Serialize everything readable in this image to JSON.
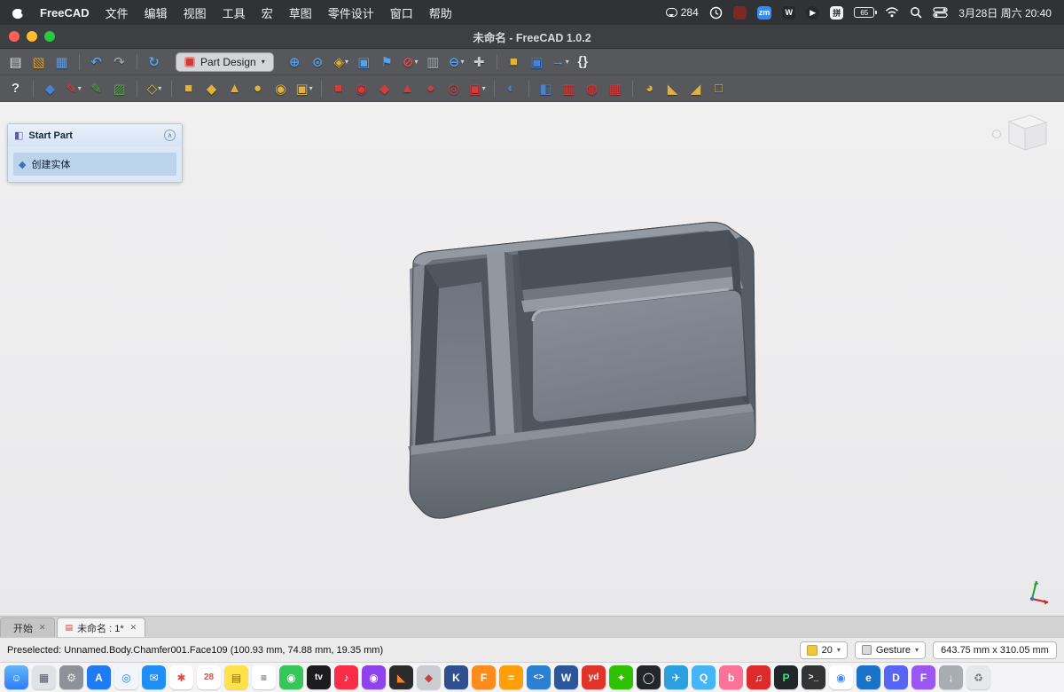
{
  "menu_bar": {
    "app_name": "FreeCAD",
    "items": [
      "文件",
      "编辑",
      "视图",
      "工具",
      "宏",
      "草图",
      "零件设计",
      "窗口",
      "帮助"
    ],
    "status": {
      "chat_count": "284",
      "zoom_badge": "zm",
      "word_badge": "W",
      "play_glyph": "▶",
      "pinyin_badge": "拼",
      "battery_percent": "65",
      "datetime": "3月28日 周六 20:40"
    }
  },
  "window": {
    "title": "未命名 - FreeCAD 1.0.2"
  },
  "toolbars": {
    "workbench_selector": {
      "label": "Part Design",
      "arrow": "▾"
    },
    "row1_left": [
      {
        "name": "new-file-icon",
        "glyph": "▤",
        "style": "color:#e9edf2"
      },
      {
        "name": "open-folder-icon",
        "glyph": "▧",
        "style": "color:#e0a23c"
      },
      {
        "name": "save-icon",
        "glyph": "▦",
        "style": "color:#6fa0d8"
      },
      {
        "cls": "tsep",
        "inter": "false"
      },
      {
        "name": "undo-icon",
        "glyph": "↶",
        "style": "color:#58a0e8"
      },
      {
        "name": "redo-icon",
        "glyph": "↷",
        "style": "color:#9aa0a6"
      },
      {
        "cls": "tsep",
        "inter": "false"
      },
      {
        "name": "refresh-icon",
        "glyph": "↻",
        "style": "color:#58a0e8"
      }
    ],
    "row1_view": [
      {
        "name": "fit-all-icon",
        "glyph": "⊕",
        "style": "color:#58a0e8"
      },
      {
        "name": "fit-selection-icon",
        "glyph": "⊙",
        "style": "color:#58a0e8"
      },
      {
        "name": "isometric-view-icon",
        "glyph": "◈",
        "style": "color:#d9b23c",
        "dd": "▾"
      },
      {
        "name": "box-zoom-icon",
        "glyph": "▣",
        "style": "color:#58a0e8"
      },
      {
        "name": "sync-view-icon",
        "glyph": "⚑",
        "style": "color:#58a0e8"
      },
      {
        "name": "draw-style-icon",
        "glyph": "⊘",
        "style": "color:#e05252",
        "dd": "▾"
      },
      {
        "name": "clip-plane-icon",
        "glyph": "▥",
        "style": "color:#9fb3c8"
      },
      {
        "name": "zoom-out-icon",
        "glyph": "⊖",
        "style": "color:#58a0e8",
        "dd": "▾"
      },
      {
        "name": "measure-icon",
        "glyph": "✚",
        "style": "color:#c7ccd2"
      },
      {
        "cls": "tsep",
        "inter": "false"
      },
      {
        "name": "part-icon",
        "glyph": "■",
        "style": "color:#e2b33c"
      },
      {
        "name": "group-icon",
        "glyph": "▣",
        "style": "color:#4a80d0"
      },
      {
        "name": "export-icon",
        "glyph": "→",
        "style": "color:#58a0e8",
        "dd": "▾"
      },
      {
        "name": "macro-braces-icon",
        "glyph": "{}",
        "style": "color:#e9edf2"
      }
    ],
    "row2": [
      {
        "name": "whatsthis-icon",
        "glyph": "?",
        "style": "color:#e9edf2"
      },
      {
        "cls": "tsep",
        "inter": "false"
      },
      {
        "name": "create-body-icon",
        "glyph": "◆",
        "style": "color:#4a80d0"
      },
      {
        "name": "create-sketch-icon",
        "glyph": "✎",
        "style": "color:#d84b4b",
        "dd": "▾"
      },
      {
        "name": "edit-sketch-icon",
        "glyph": "✎",
        "style": "color:#57a64a"
      },
      {
        "name": "map-sketch-icon",
        "glyph": "▨",
        "style": "color:#57a64a"
      },
      {
        "cls": "tsep",
        "inter": "false"
      },
      {
        "name": "create-datum-icon",
        "glyph": "◇",
        "style": "color:#e2b33c",
        "dd": "▾"
      },
      {
        "cls": "tsep",
        "inter": "false"
      },
      {
        "name": "pad-icon",
        "glyph": "■",
        "style": "color:#e2b33c"
      },
      {
        "name": "revolution-icon",
        "glyph": "◆",
        "style": "color:#e2b33c"
      },
      {
        "name": "additive-loft-icon",
        "glyph": "▲",
        "style": "color:#e2b33c"
      },
      {
        "name": "additive-pipe-icon",
        "glyph": "●",
        "style": "color:#e2b33c"
      },
      {
        "name": "additive-helix-icon",
        "glyph": "◉",
        "style": "color:#e2b33c"
      },
      {
        "name": "additive-primitive-icon",
        "glyph": "▣",
        "style": "color:#e2b33c",
        "dd": "▾"
      },
      {
        "cls": "tsep",
        "inter": "false"
      },
      {
        "name": "pocket-icon",
        "glyph": "■",
        "style": "color:#cf3d3d"
      },
      {
        "name": "hole-icon",
        "glyph": "◉",
        "style": "color:#cf3d3d"
      },
      {
        "name": "groove-icon",
        "glyph": "◆",
        "style": "color:#cf3d3d"
      },
      {
        "name": "subtractive-loft-icon",
        "glyph": "▲",
        "style": "color:#cf3d3d"
      },
      {
        "name": "subtractive-pipe-icon",
        "glyph": "●",
        "style": "color:#cf3d3d"
      },
      {
        "name": "subtractive-helix-icon",
        "glyph": "◎",
        "style": "color:#cf3d3d"
      },
      {
        "name": "subtractive-primitive-icon",
        "glyph": "▣",
        "style": "color:#cf3d3d",
        "dd": "▾"
      },
      {
        "cls": "tsep",
        "inter": "false"
      },
      {
        "name": "boolean-icon",
        "glyph": "◐",
        "style": "color:#4a80d0"
      },
      {
        "cls": "tsep",
        "inter": "false"
      },
      {
        "name": "mirrored-icon",
        "glyph": "◧",
        "style": "color:#4a80d0"
      },
      {
        "name": "linear-pattern-icon",
        "glyph": "▥",
        "style": "color:#cf3d3d"
      },
      {
        "name": "polar-pattern-icon",
        "glyph": "◍",
        "style": "color:#cf3d3d"
      },
      {
        "name": "multitransform-icon",
        "glyph": "▦",
        "style": "color:#cf3d3d"
      },
      {
        "cls": "tsep",
        "inter": "false"
      },
      {
        "name": "fillet-icon",
        "glyph": "◕",
        "style": "color:#e2b33c"
      },
      {
        "name": "chamfer-icon",
        "glyph": "◣",
        "style": "color:#e2b33c"
      },
      {
        "name": "draft-icon",
        "glyph": "◢",
        "style": "color:#e2b33c"
      },
      {
        "name": "thickness-icon",
        "glyph": "□",
        "style": "color:#e2b33c"
      }
    ]
  },
  "task_panel": {
    "title": "Start Part",
    "collapse_glyph": "∧",
    "items": [
      {
        "name": "create-solid-item",
        "label": "创建实体",
        "glyph": "◆",
        "style": "color:#3f6fb5"
      }
    ]
  },
  "tab_bar": {
    "tabs": [
      {
        "name": "tab-start",
        "label": "开始",
        "close": "✕",
        "cls": "tab"
      },
      {
        "name": "tab-document",
        "label": "未命名 : 1*",
        "close": "✕",
        "cls": "tab active",
        "icon": "▤",
        "iconstyle": "color:#cf3d3d"
      }
    ]
  },
  "status_bar": {
    "message": "Preselected: Unnamed.Body.Chamfer001.Face109 (100.93 mm, 74.88 mm, 19.35 mm)",
    "scale_value": "20",
    "nav_style": "Gesture",
    "dimensions": "643.75 mm x 310.05 mm",
    "arrow": "▾"
  },
  "dock": {
    "items": [
      {
        "name": "dock-finder-icon",
        "glyph": "☺",
        "style": "background:linear-gradient(180deg,#63b6f7,#2f7cf6);color:#fff"
      },
      {
        "name": "dock-launchpad-icon",
        "glyph": "▦",
        "style": "background:#dfe3e8;color:#556"
      },
      {
        "name": "dock-settings-icon",
        "glyph": "⚙",
        "style": "background:#8e9298;color:#f2f2f2"
      },
      {
        "name": "dock-appstore-icon",
        "glyph": "A",
        "style": "background:#1f7bf4;color:#fff"
      },
      {
        "name": "dock-safari-icon",
        "glyph": "◎",
        "style": "background:#f2f6fb;color:#1f7bf4"
      },
      {
        "name": "dock-mail-icon",
        "glyph": "✉",
        "style": "background:#1f8ef4;color:#fff"
      },
      {
        "name": "dock-photos-icon",
        "glyph": "✱",
        "style": "background:#fff;color:#e8453c"
      },
      {
        "name": "dock-calendar-icon",
        "glyph": "28",
        "style": "background:#fff;color:#e8453c;font-size:10px"
      },
      {
        "name": "dock-notes-icon",
        "glyph": "▤",
        "style": "background:#ffe14a;color:#8a6d00"
      },
      {
        "name": "dock-reminders-icon",
        "glyph": "≡",
        "style": "background:#fff;color:#444"
      },
      {
        "name": "dock-facetime-icon",
        "glyph": "◉",
        "style": "background:#35c759;color:#fff"
      },
      {
        "name": "dock-appletv-icon",
        "glyph": "tv",
        "style": "background:#1c1c1e;color:#fff;font-size:10px"
      },
      {
        "name": "dock-music-icon",
        "glyph": "♪",
        "style": "background:#fa2d48;color:#fff"
      },
      {
        "name": "dock-podcasts-icon",
        "glyph": "◉",
        "style": "background:#8e44ec;color:#fff"
      },
      {
        "name": "dock-blender-icon",
        "glyph": "◣",
        "style": "background:#2b2b2b;color:#ff7f2a"
      },
      {
        "name": "dock-freecad-icon",
        "glyph": "◆",
        "style": "background:#c9ccd1;color:#cf3d3d"
      },
      {
        "name": "dock-kicad-icon",
        "glyph": "K",
        "style": "background:#314f8f;color:#fff"
      },
      {
        "name": "dock-fusion-icon",
        "glyph": "F",
        "style": "background:#ff8c1a;color:#fff"
      },
      {
        "name": "dock-calculator-icon",
        "glyph": "=",
        "style": "background:#ff9f0a;color:#fff"
      },
      {
        "name": "dock-vscode-icon",
        "glyph": "<>",
        "style": "background:#2b80d4;color:#fff;font-size:10px"
      },
      {
        "name": "dock-word-icon",
        "glyph": "W",
        "style": "background:#2b579a;color:#fff"
      },
      {
        "name": "dock-youdao-icon",
        "glyph": "yd",
        "style": "background:#e0342b;color:#fff;font-size:10px"
      },
      {
        "name": "dock-wechat-icon",
        "glyph": "✦",
        "style": "background:#2dc100;color:#fff"
      },
      {
        "name": "dock-obs-icon",
        "glyph": "◯",
        "style": "background:#23272b;color:#fff"
      },
      {
        "name": "dock-telegram-icon",
        "glyph": "✈",
        "style": "background:#2aa1de;color:#fff"
      },
      {
        "name": "dock-qq-icon",
        "glyph": "Q",
        "style": "background:#44b6f7;color:#fff"
      },
      {
        "name": "dock-bilibili-icon",
        "glyph": "b",
        "style": "background:#fb7299;color:#fff"
      },
      {
        "name": "dock-netease-music-icon",
        "glyph": "♫",
        "style": "background:#dd2a2a;color:#fff"
      },
      {
        "name": "dock-pycharm-icon",
        "glyph": "P",
        "style": "background:#21262b;color:#3ddc84"
      },
      {
        "name": "dock-terminal-icon",
        "glyph": ">_",
        "style": "background:#333;color:#fff;font-size:10px"
      },
      {
        "name": "dock-chrome-icon",
        "glyph": "◉",
        "style": "background:#fff;color:#4285f4"
      },
      {
        "name": "dock-edge-icon",
        "glyph": "e",
        "style": "background:#1a73c9;color:#fff"
      },
      {
        "name": "dock-discord-icon",
        "glyph": "D",
        "style": "background:#5865f2;color:#fff"
      },
      {
        "name": "dock-figma-icon",
        "glyph": "F",
        "style": "background:#9a57f2;color:#fff"
      },
      {
        "name": "dock-downloads-icon",
        "glyph": "↓",
        "style": "background:#a8adb4;color:#fff"
      },
      {
        "name": "dock-trash-icon",
        "glyph": "♻",
        "style": "background:#e6e7e9;color:#777"
      }
    ]
  }
}
